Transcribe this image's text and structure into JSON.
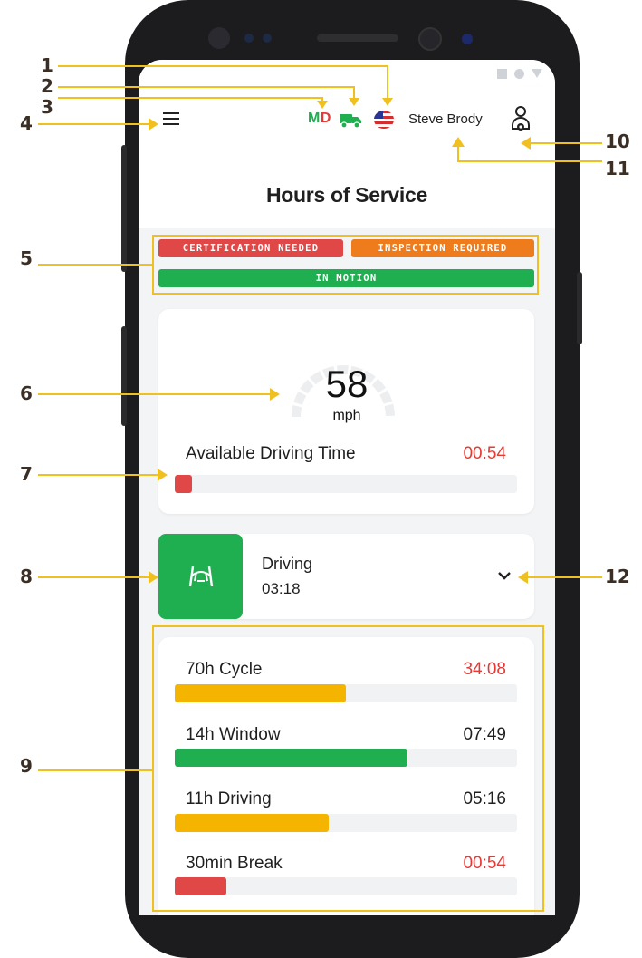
{
  "header": {
    "jurisdiction": {
      "first": "M",
      "second": "D"
    },
    "driver_name": "Steve Brody",
    "page_title": "Hours of Service",
    "icons": {
      "menu": "hamburger-icon",
      "truck": "truck-icon",
      "flag": "us-flag-icon",
      "profile": "driver-profile-icon"
    }
  },
  "alerts": [
    {
      "label": "CERTIFICATION NEEDED",
      "color": "#e04848"
    },
    {
      "label": "INSPECTION REQUIRED",
      "color": "#ee7b1c"
    },
    {
      "label": "IN MOTION",
      "color": "#1fae50"
    }
  ],
  "speed": {
    "value": "58",
    "unit": "mph"
  },
  "available_driving": {
    "label": "Available Driving Time",
    "value": "00:54",
    "fraction": 0.04,
    "color": "#e04848"
  },
  "duty_status": {
    "label": "Driving",
    "time": "03:18",
    "icon": "steering-road-icon",
    "color": "#1fae50"
  },
  "clocks": [
    {
      "label": "70h Cycle",
      "value": "34:08",
      "value_color": "#e53935",
      "fill_color": "#f4b400",
      "fraction": 0.5
    },
    {
      "label": "14h Window",
      "value": "07:49",
      "value_color": "#1f1f1f",
      "fill_color": "#1fae50",
      "fraction": 0.68
    },
    {
      "label": "11h Driving",
      "value": "05:16",
      "value_color": "#1f1f1f",
      "fill_color": "#f4b400",
      "fraction": 0.45
    },
    {
      "label": "30min Break",
      "value": "00:54",
      "value_color": "#e53935",
      "fill_color": "#e04848",
      "fraction": 0.15
    }
  ],
  "callouts": [
    "1",
    "2",
    "3",
    "4",
    "5",
    "6",
    "7",
    "8",
    "9",
    "10",
    "11",
    "12"
  ]
}
